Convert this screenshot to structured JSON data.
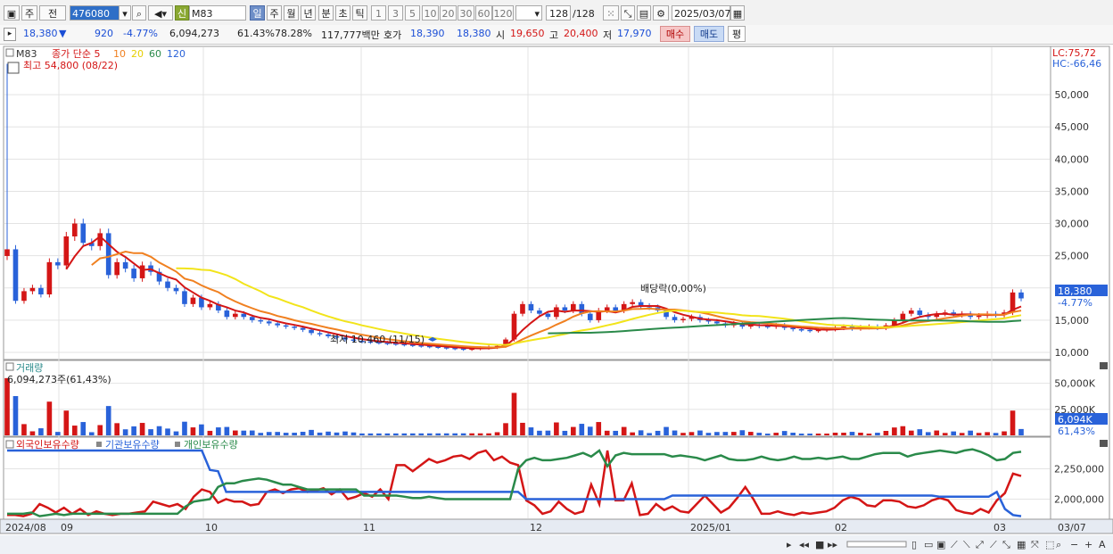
{
  "toolbar": {
    "mode_primary": "주",
    "mode_prev": "전",
    "stock_code": "476080",
    "badge_new": "신",
    "stock_name": "M83",
    "periods": [
      "일",
      "주",
      "월",
      "년",
      "분",
      "초",
      "틱"
    ],
    "active_period": "일",
    "intervals": [
      "1",
      "3",
      "5",
      "10",
      "20",
      "30",
      "60",
      "120"
    ],
    "count": "128",
    "count_total": "/128",
    "date": "2025/03/07"
  },
  "quote": {
    "price": "18,380",
    "change": "920",
    "change_pct": "-4.77%",
    "volume": "6,094,273",
    "volume_ratio": "61.43%",
    "turnover_ratio": "78.28%",
    "amount": "117,777백만",
    "hoga_label": "호가",
    "ask": "18,390",
    "bid": "18,380",
    "open_label": "시",
    "open": "19,650",
    "high_label": "고",
    "high": "20,400",
    "low_label": "저",
    "low": "17,970",
    "buy_label": "매수",
    "sell_label": "매도",
    "eval_label": "평"
  },
  "price_panel": {
    "name_tag": "M83",
    "ma_label": "종가 단순 5",
    "ma_periods": [
      "10",
      "20",
      "60",
      "120"
    ],
    "high_note": "최고 54,800 (08/22)",
    "low_note": "최저 10,460 (11/15)",
    "dividend_note": "배당락(0,00%)",
    "lc": "LC:75,72",
    "hc": "HC:-66,46",
    "current_price_tag": "18,380",
    "current_pct_tag": "-4.77%",
    "y_ticks": [
      "50,000",
      "45,000",
      "40,000",
      "35,000",
      "30,000",
      "25,000",
      "20,000",
      "15,000",
      "10,000"
    ]
  },
  "volume_panel": {
    "title": "거래량",
    "readout": "6,094,273주(61,43%)",
    "y_ticks": [
      "50,000K",
      "25,000K"
    ],
    "tag_value": "6,094K",
    "tag_pct": "61,43%"
  },
  "holdings_panel": {
    "legend": [
      "외국인보유수량",
      "기관보유수량",
      "개인보유수량"
    ],
    "y_ticks": [
      "2,250,000",
      "2,000,000"
    ]
  },
  "x_axis": {
    "labels": [
      "2024/08",
      "09",
      "10",
      "11",
      "12",
      "2025/01",
      "02",
      "03"
    ],
    "end_label": "03/07"
  },
  "chart_data": {
    "type": "candlestick",
    "ylim": [
      10000,
      55000
    ],
    "y_ticks": [
      10000,
      15000,
      20000,
      25000,
      30000,
      35000,
      40000,
      45000,
      50000
    ],
    "highest": {
      "value": 54800,
      "date": "08/22"
    },
    "lowest": {
      "value": 10460,
      "date": "11/15"
    },
    "last_close": 18380,
    "last_volume": 6094273,
    "month_labels": [
      "2024/08",
      "09",
      "10",
      "11",
      "12",
      "2025/01",
      "02",
      "03"
    ],
    "close_series": [
      26000,
      18000,
      19500,
      20000,
      19000,
      24000,
      23500,
      28000,
      30000,
      27000,
      26500,
      28500,
      22000,
      24000,
      23000,
      21500,
      23500,
      22500,
      21000,
      20000,
      19500,
      17500,
      18500,
      17000,
      17500,
      16500,
      15500,
      16000,
      15500,
      15000,
      14800,
      14500,
      14200,
      14000,
      13800,
      13500,
      13000,
      12800,
      12500,
      12300,
      12000,
      11800,
      11700,
      11600,
      11500,
      11400,
      11300,
      11200,
      11100,
      11000,
      10900,
      10800,
      10700,
      10600,
      10500,
      10600,
      10700,
      10800,
      11000,
      12000,
      16000,
      17500,
      16500,
      16000,
      15500,
      17000,
      16500,
      17500,
      16000,
      15000,
      16500,
      17000,
      16500,
      17500,
      17800,
      17200,
      17000,
      16500,
      15500,
      15000,
      15200,
      15500,
      15000,
      14800,
      14500,
      14200,
      14500,
      14000,
      14300,
      14100,
      14000,
      14200,
      13800,
      13600,
      13500,
      13400,
      13500,
      13600,
      13800,
      14000,
      13700,
      13900,
      14000,
      13800,
      14200,
      15000,
      16000,
      16500,
      15800,
      15500,
      16000,
      16200,
      15800,
      16000,
      15500,
      15700,
      16000,
      15800,
      16200,
      19300,
      18380
    ],
    "volume_ylim": [
      0,
      60000000
    ],
    "volume_ticks": [
      25000000,
      50000000
    ],
    "holdings_ylim": [
      1850000,
      2400000
    ],
    "holdings_ticks": [
      2000000,
      2250000
    ],
    "series": [
      {
        "name": "외국인보유수량",
        "color": "#d41616",
        "values": [
          1870000,
          1870000,
          1860000,
          1880000,
          1960000,
          1930000,
          1890000,
          1930000,
          1880000,
          1920000,
          1870000,
          1900000,
          1880000,
          1870000,
          1880000,
          1880000,
          1890000,
          1900000,
          1980000,
          1960000,
          1940000,
          1960000,
          1920000,
          2020000,
          2080000,
          2060000,
          1970000,
          2000000,
          1980000,
          1980000,
          1950000,
          1960000,
          2060000,
          2080000,
          2050000,
          2080000,
          2090000,
          2060000,
          2070000,
          2090000,
          2040000,
          2080000,
          2000000,
          2020000,
          2050000,
          2020000,
          2080000,
          2000000,
          2280000,
          2280000,
          2230000,
          2280000,
          2330000,
          2300000,
          2320000,
          2350000,
          2360000,
          2330000,
          2380000,
          2400000,
          2320000,
          2350000,
          2300000,
          2280000,
          1990000,
          1950000,
          1880000,
          1900000,
          1980000,
          1920000,
          1880000,
          1900000,
          2120000,
          1960000,
          2400000,
          1990000,
          1990000,
          2130000,
          1870000,
          1880000,
          1960000,
          1910000,
          1940000,
          1900000,
          1890000,
          1960000,
          2030000,
          1960000,
          1890000,
          1930000,
          2010000,
          2100000,
          2000000,
          1880000,
          1880000,
          1900000,
          1880000,
          1870000,
          1890000,
          1880000,
          1890000,
          1900000,
          1930000,
          1990000,
          2020000,
          2000000,
          1950000,
          1940000,
          1990000,
          1990000,
          1980000,
          1940000,
          1930000,
          1950000,
          1990000,
          2010000,
          1990000,
          1910000,
          1890000,
          1880000,
          1920000,
          1890000,
          1990000,
          2050000,
          2210000,
          2190000
        ]
      },
      {
        "name": "기관보유수량",
        "color": "#2962d9",
        "values": [
          2400000,
          2400000,
          2400000,
          2400000,
          2400000,
          2400000,
          2400000,
          2400000,
          2400000,
          2400000,
          2400000,
          2400000,
          2400000,
          2400000,
          2400000,
          2400000,
          2400000,
          2400000,
          2400000,
          2400000,
          2400000,
          2400000,
          2400000,
          2400000,
          2400000,
          2240000,
          2230000,
          2060000,
          2060000,
          2060000,
          2060000,
          2060000,
          2060000,
          2060000,
          2060000,
          2060000,
          2060000,
          2060000,
          2060000,
          2060000,
          2060000,
          2060000,
          2060000,
          2060000,
          2060000,
          2060000,
          2060000,
          2060000,
          2060000,
          2060000,
          2060000,
          2060000,
          2060000,
          2060000,
          2060000,
          2060000,
          2060000,
          2060000,
          2060000,
          2060000,
          2060000,
          2060000,
          2060000,
          2060000,
          2000000,
          2000000,
          2000000,
          2000000,
          2000000,
          2000000,
          2000000,
          2000000,
          2000000,
          2000000,
          2000000,
          2000000,
          2000000,
          2000000,
          2000000,
          2000000,
          2000000,
          2000000,
          2030000,
          2030000,
          2030000,
          2030000,
          2030000,
          2030000,
          2030000,
          2030000,
          2030000,
          2030000,
          2030000,
          2030000,
          2030000,
          2030000,
          2030000,
          2030000,
          2030000,
          2030000,
          2030000,
          2030000,
          2030000,
          2030000,
          2030000,
          2030000,
          2030000,
          2030000,
          2030000,
          2030000,
          2030000,
          2030000,
          2030000,
          2030000,
          2030000,
          2020000,
          2020000,
          2020000,
          2020000,
          2020000,
          2020000,
          2020000,
          2060000,
          1920000,
          1870000,
          1860000
        ]
      },
      {
        "name": "개인보유수량",
        "color": "#2a8a4a",
        "values": [
          1880000,
          1880000,
          1880000,
          1890000,
          1860000,
          1870000,
          1880000,
          1870000,
          1880000,
          1880000,
          1880000,
          1880000,
          1880000,
          1880000,
          1880000,
          1880000,
          1880000,
          1880000,
          1880000,
          1880000,
          1880000,
          1880000,
          1940000,
          1980000,
          1990000,
          2000000,
          2100000,
          2130000,
          2130000,
          2150000,
          2160000,
          2170000,
          2160000,
          2140000,
          2120000,
          2120000,
          2100000,
          2080000,
          2080000,
          2080000,
          2080000,
          2080000,
          2080000,
          2080000,
          2030000,
          2030000,
          2030000,
          2030000,
          2030000,
          2020000,
          2010000,
          2010000,
          2020000,
          2010000,
          2000000,
          2000000,
          2000000,
          2000000,
          2000000,
          2000000,
          2000000,
          2000000,
          2000000,
          2250000,
          2320000,
          2340000,
          2320000,
          2320000,
          2330000,
          2340000,
          2360000,
          2380000,
          2350000,
          2400000,
          2270000,
          2360000,
          2380000,
          2370000,
          2370000,
          2370000,
          2370000,
          2370000,
          2350000,
          2360000,
          2350000,
          2340000,
          2320000,
          2340000,
          2360000,
          2330000,
          2320000,
          2320000,
          2330000,
          2350000,
          2330000,
          2320000,
          2330000,
          2350000,
          2330000,
          2330000,
          2340000,
          2330000,
          2340000,
          2350000,
          2330000,
          2330000,
          2350000,
          2370000,
          2380000,
          2380000,
          2380000,
          2350000,
          2370000,
          2380000,
          2390000,
          2400000,
          2390000,
          2380000,
          2400000,
          2410000,
          2390000,
          2360000,
          2320000,
          2330000,
          2380000,
          2390000
        ]
      }
    ]
  },
  "bottom_bar": {
    "nav_icons": [
      "play-right-icon",
      "rewind-icon",
      "stop-icon",
      "fast-forward-icon"
    ],
    "zoom_minus": "−",
    "zoom_plus": "+",
    "auto_label": "A"
  }
}
